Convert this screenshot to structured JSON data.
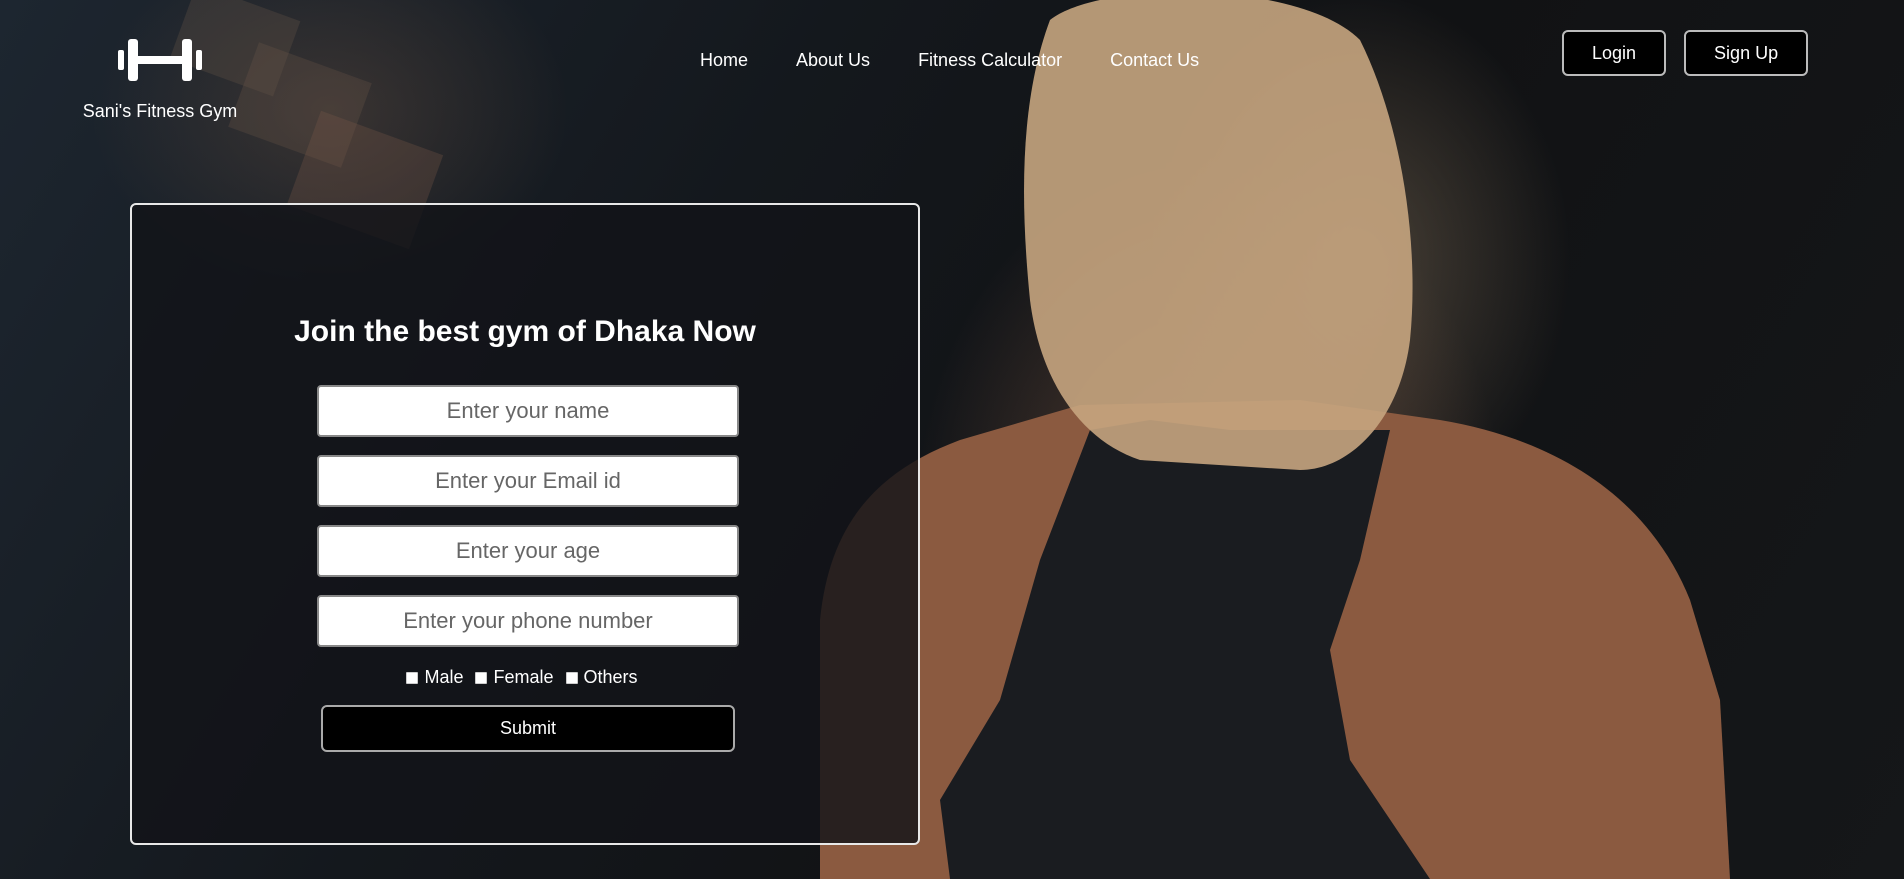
{
  "brand": {
    "logo_icon": "dumbbell-icon",
    "name": "Sani's Fitness Gym"
  },
  "nav": {
    "items": [
      {
        "label": "Home"
      },
      {
        "label": "About Us"
      },
      {
        "label": "Fitness Calculator"
      },
      {
        "label": "Contact Us"
      }
    ]
  },
  "auth": {
    "login_label": "Login",
    "signup_label": "Sign Up"
  },
  "form": {
    "title": "Join the best gym of Dhaka Now",
    "name_placeholder": "Enter your name",
    "email_placeholder": "Enter your Email id",
    "age_placeholder": "Enter your age",
    "phone_placeholder": "Enter your phone number",
    "gender_options": [
      {
        "label": "Male"
      },
      {
        "label": "Female"
      },
      {
        "label": "Others"
      }
    ],
    "submit_label": "Submit"
  },
  "colors": {
    "background": "#111316",
    "accent": "#000000",
    "text": "#ffffff"
  }
}
